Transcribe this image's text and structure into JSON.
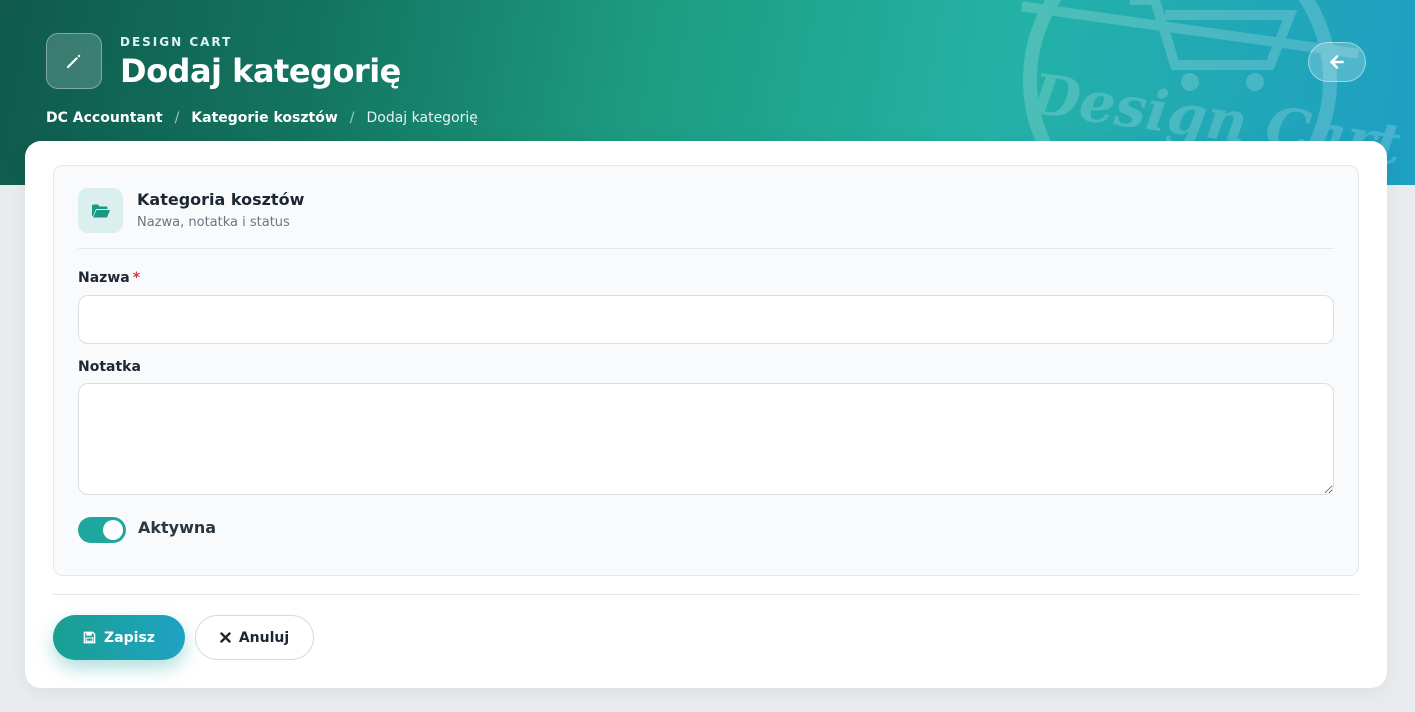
{
  "header": {
    "kicker": "DESIGN CART",
    "title": "Dodaj kategorię",
    "breadcrumb": [
      {
        "label": "DC Accountant"
      },
      {
        "label": "Kategorie kosztów"
      },
      {
        "label": "Dodaj kategorię"
      }
    ],
    "separator": "/",
    "watermark_text": "Design Cart"
  },
  "section": {
    "title": "Kategoria kosztów",
    "subtitle": "Nazwa, notatka i status"
  },
  "form": {
    "name_label": "Nazwa",
    "required_mark": "*",
    "name_value": "",
    "note_label": "Notatka",
    "note_value": "",
    "active_label": "Aktywna",
    "active": true
  },
  "actions": {
    "save_label": "Zapisz",
    "cancel_label": "Anuluj"
  },
  "icons": {
    "hero": "pencil-icon",
    "back": "arrow-left-icon",
    "section": "folder-open-icon",
    "save": "floppy-disk-icon",
    "cancel": "x-icon"
  },
  "colors": {
    "accent": "#1ea79c",
    "required": "#d23b48"
  }
}
